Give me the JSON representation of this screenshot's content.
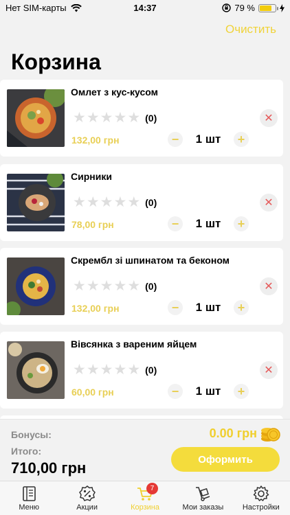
{
  "status": {
    "carrier": "Нет SIM-карты",
    "time": "14:37",
    "battery": "79 %",
    "battery_level": 0.79
  },
  "header": {
    "clear_label": "Очистить",
    "title": "Корзина"
  },
  "cart": {
    "items": [
      {
        "name": "Омлет з кус-кусом",
        "rating_count": "(0)",
        "price": "132,00 грн",
        "qty": "1 шт",
        "rating": 0
      },
      {
        "name": "Сирники",
        "rating_count": "(0)",
        "price": "78,00 грн",
        "qty": "1 шт",
        "rating": 0
      },
      {
        "name": "Скрембл зі шпинатом та беконом",
        "rating_count": "(0)",
        "price": "132,00 грн",
        "qty": "1 шт",
        "rating": 0
      },
      {
        "name": "Вівсянка з вареним яйцем",
        "rating_count": "(0)",
        "price": "60,00 грн",
        "qty": "1 шт",
        "rating": 0
      }
    ]
  },
  "footer": {
    "bonus_label": "Бонусы:",
    "bonus_value": "0.00 грн",
    "total_label": "Итого:",
    "total_value": "710,00 грн",
    "checkout_label": "Оформить"
  },
  "tabs": [
    {
      "label": "Меню",
      "icon": "menu-book-icon"
    },
    {
      "label": "Акции",
      "icon": "discount-icon"
    },
    {
      "label": "Корзина",
      "icon": "cart-icon",
      "badge": "7",
      "active": true
    },
    {
      "label": "Мои заказы",
      "icon": "hand-truck-icon"
    },
    {
      "label": "Настройки",
      "icon": "gear-icon"
    }
  ],
  "colors": {
    "accent": "#f0cf2e",
    "price": "#e8cf55",
    "remove": "#e55a5a",
    "badge": "#e53935"
  }
}
